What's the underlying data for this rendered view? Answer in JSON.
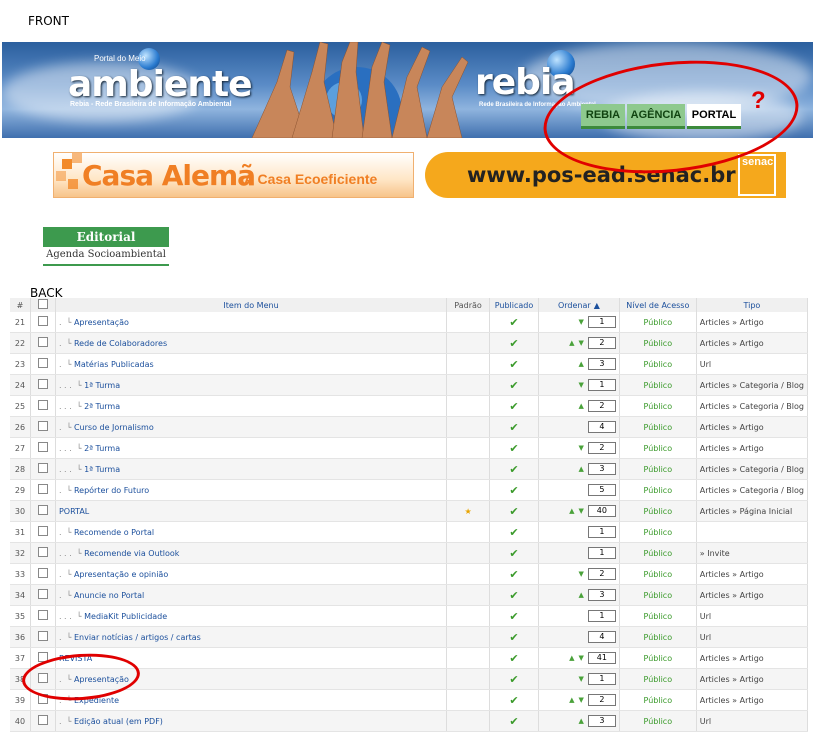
{
  "labels": {
    "front": "FRONT",
    "back": "BACK"
  },
  "banner": {
    "logo_left_top": "Portal do Meio",
    "logo_left": "ambiente",
    "logo_left_sub": "Rebia - Rede Brasileira de Informação Ambiental",
    "logo_right": "rebia",
    "logo_right_sub": "Rede Brasileira de Informação Ambiental",
    "nav": [
      "REBIA",
      "AGÊNCIA",
      "PORTAL"
    ],
    "annotation": "?"
  },
  "ads": {
    "casa_title": "Casa Alemã",
    "casa_sub": "A Casa Ecoeficiente",
    "senac_url": "www.pos-ead.senac.br",
    "senac_logo": "senac"
  },
  "editorial": {
    "button": "Editorial",
    "link": "Agenda Socioambiental"
  },
  "table": {
    "headers": {
      "num": "#",
      "item": "Item do Menu",
      "default": "Padrão",
      "published": "Publicado",
      "order": "Ordenar",
      "access": "Nível de Acesso",
      "type": "Tipo"
    },
    "rows": [
      {
        "n": "21",
        "name": "Apresentação",
        "dots": ".",
        "depth": 1,
        "default": false,
        "up": false,
        "down": true,
        "order": "1",
        "access": "Público",
        "type": "Articles » Artigo"
      },
      {
        "n": "22",
        "name": "Rede de Colaboradores",
        "dots": ".",
        "depth": 1,
        "default": false,
        "up": true,
        "down": true,
        "order": "2",
        "access": "Público",
        "type": "Articles » Artigo"
      },
      {
        "n": "23",
        "name": "Matérias Publicadas",
        "dots": ".",
        "depth": 1,
        "default": false,
        "up": true,
        "down": false,
        "order": "3",
        "access": "Público",
        "type": "Url"
      },
      {
        "n": "24",
        "name": "1ª Turma",
        "dots": ".    .    .",
        "depth": 3,
        "default": false,
        "up": false,
        "down": true,
        "order": "1",
        "access": "Público",
        "type": "Articles » Categoria / Blog"
      },
      {
        "n": "25",
        "name": "2ª Turma",
        "dots": ".    .    .",
        "depth": 3,
        "default": false,
        "up": true,
        "down": false,
        "order": "2",
        "access": "Público",
        "type": "Articles » Categoria / Blog"
      },
      {
        "n": "26",
        "name": "Curso de Jornalismo",
        "dots": ".",
        "depth": 1,
        "default": false,
        "up": false,
        "down": false,
        "order": "4",
        "access": "Público",
        "type": "Articles » Artigo"
      },
      {
        "n": "27",
        "name": "2ª Turma",
        "dots": ".    .    .",
        "depth": 3,
        "default": false,
        "up": false,
        "down": true,
        "order": "2",
        "access": "Público",
        "type": "Articles » Artigo"
      },
      {
        "n": "28",
        "name": "1ª Turma",
        "dots": ".    .    .",
        "depth": 3,
        "default": false,
        "up": true,
        "down": false,
        "order": "3",
        "access": "Público",
        "type": "Articles » Categoria / Blog"
      },
      {
        "n": "29",
        "name": "Repórter do Futuro",
        "dots": ".",
        "depth": 1,
        "default": false,
        "up": false,
        "down": false,
        "order": "5",
        "access": "Público",
        "type": "Articles » Categoria / Blog"
      },
      {
        "n": "30",
        "name": "PORTAL",
        "dots": "",
        "depth": 0,
        "default": true,
        "up": true,
        "down": true,
        "order": "40",
        "access": "Público",
        "type": "Articles » Página Inicial"
      },
      {
        "n": "31",
        "name": "Recomende o Portal",
        "dots": ".",
        "depth": 1,
        "default": false,
        "up": false,
        "down": false,
        "order": "1",
        "access": "Público",
        "type": ""
      },
      {
        "n": "32",
        "name": "Recomende via Outlook",
        "dots": ".    .    .",
        "depth": 3,
        "default": false,
        "up": false,
        "down": false,
        "order": "1",
        "access": "Público",
        "type": "» Invite"
      },
      {
        "n": "33",
        "name": "Apresentação e opinião",
        "dots": ".",
        "depth": 1,
        "default": false,
        "up": false,
        "down": true,
        "order": "2",
        "access": "Público",
        "type": "Articles » Artigo"
      },
      {
        "n": "34",
        "name": "Anuncie no Portal",
        "dots": ".",
        "depth": 1,
        "default": false,
        "up": true,
        "down": false,
        "order": "3",
        "access": "Público",
        "type": "Articles » Artigo"
      },
      {
        "n": "35",
        "name": "MediaKit Publicidade",
        "dots": ".    .    .",
        "depth": 3,
        "default": false,
        "up": false,
        "down": false,
        "order": "1",
        "access": "Público",
        "type": "Url"
      },
      {
        "n": "36",
        "name": "Enviar notícias / artigos / cartas",
        "dots": ".",
        "depth": 1,
        "default": false,
        "up": false,
        "down": false,
        "order": "4",
        "access": "Público",
        "type": "Url"
      },
      {
        "n": "37",
        "name": "REVISTA",
        "dots": "",
        "depth": 0,
        "default": false,
        "up": true,
        "down": true,
        "order": "41",
        "access": "Público",
        "type": "Articles » Artigo"
      },
      {
        "n": "38",
        "name": "Apresentação",
        "dots": ".",
        "depth": 1,
        "default": false,
        "up": false,
        "down": true,
        "order": "1",
        "access": "Público",
        "type": "Articles » Artigo"
      },
      {
        "n": "39",
        "name": "Expediente",
        "dots": ".",
        "depth": 1,
        "default": false,
        "up": true,
        "down": true,
        "order": "2",
        "access": "Público",
        "type": "Articles » Artigo"
      },
      {
        "n": "40",
        "name": "Edição atual (em PDF)",
        "dots": ".",
        "depth": 1,
        "default": false,
        "up": true,
        "down": false,
        "order": "3",
        "access": "Público",
        "type": "Url"
      }
    ]
  }
}
